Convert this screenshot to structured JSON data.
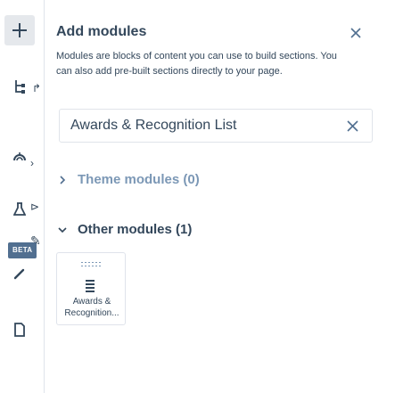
{
  "rail": {
    "items": [
      {
        "icon": "plus-icon"
      },
      {
        "icon": "tree-icon"
      },
      {
        "icon": "theme-icon"
      },
      {
        "icon": "flask-icon"
      },
      {
        "icon": "beta-icon"
      },
      {
        "icon": "page-icon"
      }
    ],
    "beta_label": "BETA"
  },
  "panel": {
    "title": "Add modules",
    "description": "Modules are blocks of content you can use to build sections. You can also add pre-built sections directly to your page.",
    "search": {
      "value": "Awards & Recognition List"
    },
    "sections": [
      {
        "label": "Theme modules (0)",
        "expanded": false
      },
      {
        "label": "Other modules (1)",
        "expanded": true
      }
    ],
    "modules": [
      {
        "label": "Awards &\nRecognition..."
      }
    ]
  },
  "colors": {
    "text": "#33475b",
    "muted": "#7c98b6",
    "border": "#dfe3eb",
    "accent_bg": "#516f90"
  }
}
